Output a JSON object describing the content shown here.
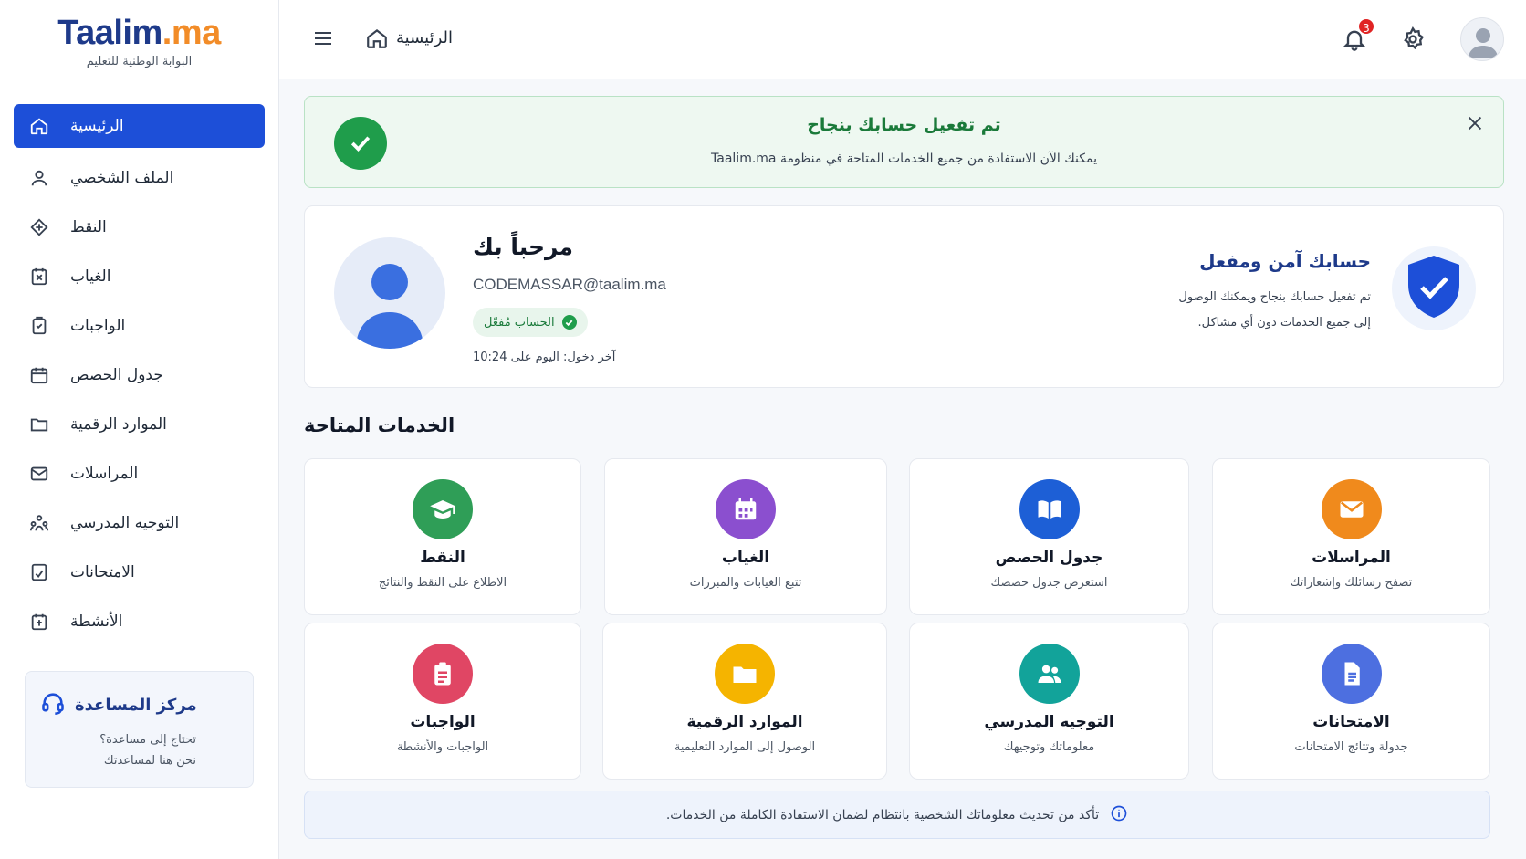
{
  "brand": {
    "name_part1": "Taalim",
    "name_part2": ".ma",
    "subtitle": "البوابة الوطنية للتعليم"
  },
  "topbar": {
    "breadcrumb": "الرئيسية",
    "notification_count": "3"
  },
  "sidebar": {
    "items": [
      {
        "label": "الرئيسية",
        "icon": "home-icon"
      },
      {
        "label": "الملف الشخصي",
        "icon": "user-icon"
      },
      {
        "label": "النقط",
        "icon": "grades-icon"
      },
      {
        "label": "الغياب",
        "icon": "absence-icon"
      },
      {
        "label": "الواجبات",
        "icon": "homework-icon"
      },
      {
        "label": "جدول الحصص",
        "icon": "calendar-icon"
      },
      {
        "label": "الموارد الرقمية",
        "icon": "folder-icon"
      },
      {
        "label": "المراسلات",
        "icon": "mail-icon"
      },
      {
        "label": "التوجيه المدرسي",
        "icon": "guidance-icon"
      },
      {
        "label": "الامتحانات",
        "icon": "exam-icon"
      },
      {
        "label": "الأنشطة",
        "icon": "activities-icon"
      }
    ],
    "help": {
      "title": "مركز المساعدة",
      "line1": "تحتاج إلى مساعدة؟",
      "line2": "نحن هنا لمساعدتك"
    }
  },
  "alert": {
    "title": "تم تفعيل حسابك بنجاح",
    "text": "يمكنك الآن الاستفادة من جميع الخدمات المتاحة في منظومة Taalim.ma"
  },
  "welcome": {
    "greeting": "مرحباً بك",
    "email": "CODEMASSAR@taalim.ma",
    "status": "الحساب مُفعّل",
    "last_login": "آخر دخول: اليوم على 10:24",
    "secure_title": "حسابك آمن ومفعل",
    "secure_line1": "تم تفعيل حسابك بنجاح ويمكنك الوصول",
    "secure_line2": "إلى جميع الخدمات دون أي مشاكل."
  },
  "services": {
    "title": "الخدمات المتاحة",
    "items": [
      {
        "title": "النقط",
        "subtitle": "الاطلاع على النقط والنتائج",
        "color": "#2f9e57",
        "icon": "graduation-cap-icon"
      },
      {
        "title": "الغياب",
        "subtitle": "تتبع الغيابات والمبررات",
        "color": "#8b4fcf",
        "icon": "calendar-icon"
      },
      {
        "title": "جدول الحصص",
        "subtitle": "استعرض جدول حصصك",
        "color": "#1d5fd6",
        "icon": "book-icon"
      },
      {
        "title": "المراسلات",
        "subtitle": "تصفح رسائلك وإشعاراتك",
        "color": "#f08a1c",
        "icon": "envelope-icon"
      },
      {
        "title": "الواجبات",
        "subtitle": "الواجبات والأنشطة",
        "color": "#e04664",
        "icon": "clipboard-icon"
      },
      {
        "title": "الموارد الرقمية",
        "subtitle": "الوصول إلى الموارد التعليمية",
        "color": "#f5b400",
        "icon": "folder-icon"
      },
      {
        "title": "التوجيه المدرسي",
        "subtitle": "معلوماتك وتوجيهك",
        "color": "#12a39a",
        "icon": "users-icon"
      },
      {
        "title": "الامتحانات",
        "subtitle": "جدولة وتتائج الامتحانات",
        "color": "#4d6fe0",
        "icon": "document-icon"
      }
    ]
  },
  "info_banner": "تأكد من تحديث معلوماتك الشخصية بانتظام لضمان الاستفادة الكاملة من الخدمات.",
  "colors": {
    "primary": "#1d4fd8",
    "brand_blue": "#1e3a8a",
    "brand_orange": "#f28c28",
    "success": "#1f9d4b"
  }
}
